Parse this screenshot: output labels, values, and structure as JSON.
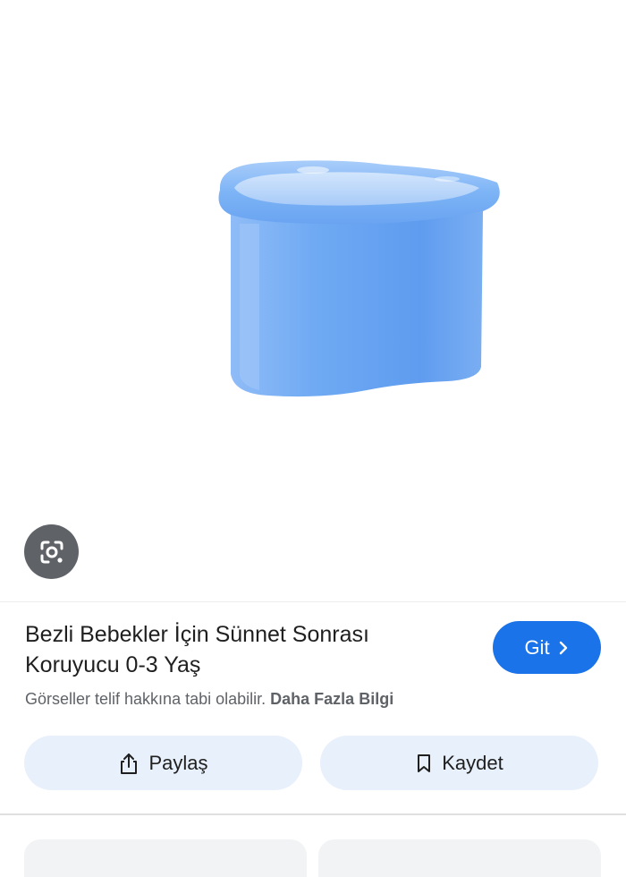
{
  "product": {
    "title": "Bezli Bebekler İçin Sünnet Sonrası Koruyucu 0-3 Yaş",
    "image_color": "#6aa8f4"
  },
  "visit_button": {
    "label": "Git",
    "icon": "chevron-right-icon",
    "color": "#1a73e8"
  },
  "copyright": {
    "text": "Görseller telif hakkına tabi olabilir.",
    "link_label": "Daha Fazla Bilgi"
  },
  "actions": {
    "share_label": "Paylaş",
    "share_icon": "share-icon",
    "save_label": "Kaydet",
    "save_icon": "bookmark-icon"
  },
  "lens": {
    "icon": "lens-search-icon"
  }
}
